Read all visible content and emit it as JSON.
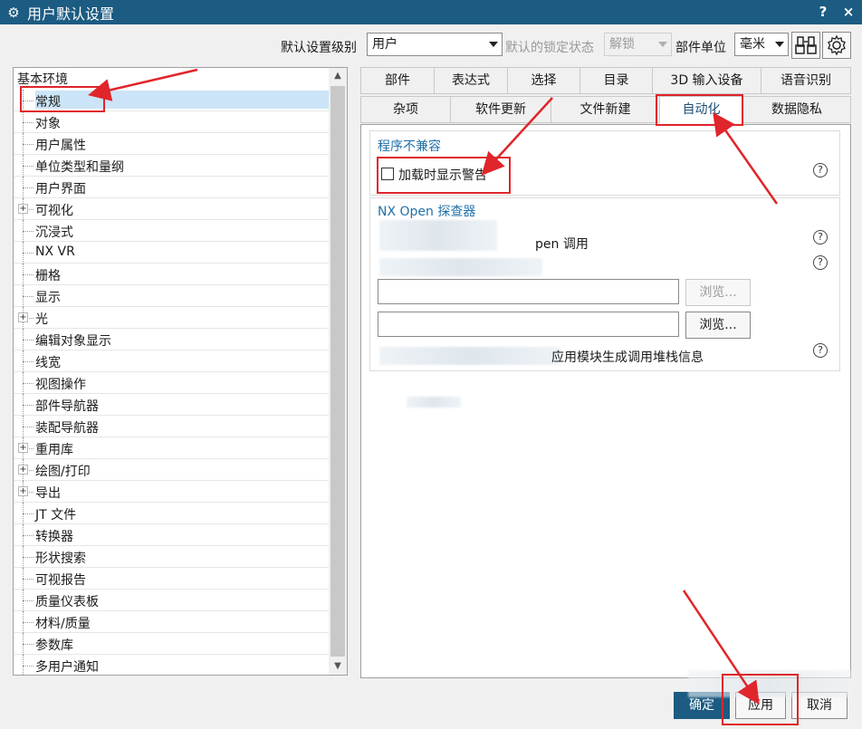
{
  "window": {
    "title": "用户默认设置",
    "help": "?",
    "close": "×"
  },
  "toolbar": {
    "level_label": "默认设置级别",
    "level_value": "用户",
    "lock_label": "默认的锁定状态",
    "lock_value": "解锁",
    "unit_label": "部件单位",
    "unit_value": "毫米"
  },
  "tree": {
    "root": "基本环境",
    "items": [
      {
        "label": "常规",
        "expandable": false,
        "selected": true
      },
      {
        "label": "对象",
        "expandable": false
      },
      {
        "label": "用户属性",
        "expandable": false
      },
      {
        "label": "单位类型和量纲",
        "expandable": false
      },
      {
        "label": "用户界面",
        "expandable": false
      },
      {
        "label": "可视化",
        "expandable": true
      },
      {
        "label": "沉浸式",
        "expandable": false
      },
      {
        "label": "NX VR",
        "expandable": false
      },
      {
        "label": "栅格",
        "expandable": false
      },
      {
        "label": "显示",
        "expandable": false
      },
      {
        "label": "光",
        "expandable": true
      },
      {
        "label": "编辑对象显示",
        "expandable": false
      },
      {
        "label": "线宽",
        "expandable": false
      },
      {
        "label": "视图操作",
        "expandable": false
      },
      {
        "label": "部件导航器",
        "expandable": false
      },
      {
        "label": "装配导航器",
        "expandable": false
      },
      {
        "label": "重用库",
        "expandable": true
      },
      {
        "label": "绘图/打印",
        "expandable": true
      },
      {
        "label": "导出",
        "expandable": true
      },
      {
        "label": "JT 文件",
        "expandable": false
      },
      {
        "label": "转换器",
        "expandable": false
      },
      {
        "label": "形状搜索",
        "expandable": false
      },
      {
        "label": "可视报告",
        "expandable": false
      },
      {
        "label": "质量仪表板",
        "expandable": false
      },
      {
        "label": "材料/质量",
        "expandable": false
      },
      {
        "label": "参数库",
        "expandable": false
      },
      {
        "label": "多用户通知",
        "expandable": false
      }
    ]
  },
  "tabs": {
    "row1": [
      "部件",
      "表达式",
      "选择",
      "目录",
      "3D 输入设备",
      "语音识别"
    ],
    "row2": [
      "杂项",
      "软件更新",
      "文件新建",
      "自动化",
      "数据隐私"
    ],
    "active": "自动化"
  },
  "content": {
    "group1_title": "程序不兼容",
    "group1_checkbox": "加载时显示警告",
    "group2_title": "NX Open 探查器",
    "group2_line1_partial": "pen 调用",
    "group2_line4_partial": "应用模块生成调用堆栈信息",
    "browse1": "浏览...",
    "browse2": "浏览..."
  },
  "footer": {
    "ok": "确定",
    "apply": "应用",
    "cancel": "取消"
  },
  "colors": {
    "titlebar": "#1c5b82",
    "annotation": "#e0252b",
    "accent_text": "#2270a8"
  }
}
